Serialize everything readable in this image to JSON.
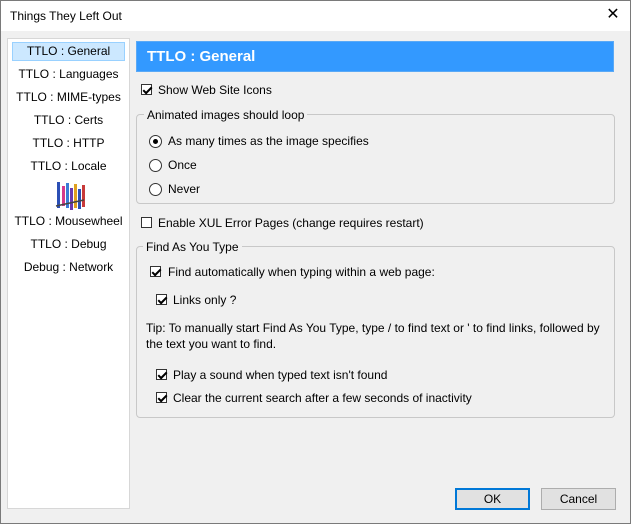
{
  "window": {
    "title": "Things They Left Out"
  },
  "sidebar": {
    "items": [
      {
        "label": "TTLO : General",
        "selected": true
      },
      {
        "label": "TTLO : Languages"
      },
      {
        "label": "TTLO : MIME-types"
      },
      {
        "label": "TTLO : Certs"
      },
      {
        "label": "TTLO : HTTP"
      },
      {
        "label": "TTLO : Locale"
      },
      {
        "label": "TTLO : Mousewheel"
      },
      {
        "label": "TTLO : Debug"
      },
      {
        "label": "Debug : Network"
      }
    ]
  },
  "header": {
    "title": "TTLO : General"
  },
  "general": {
    "show_web_site_icons": {
      "label": "Show Web Site Icons",
      "checked": true
    },
    "animated_group": {
      "legend": "Animated images should loop",
      "options": [
        {
          "label": "As many times as the image specifies",
          "selected": true
        },
        {
          "label": "Once",
          "selected": false
        },
        {
          "label": "Never",
          "selected": false
        }
      ]
    },
    "enable_xul": {
      "label": "Enable XUL Error Pages (change requires restart)",
      "checked": false
    },
    "find_group": {
      "legend": "Find As You Type",
      "find_auto": {
        "label": "Find automatically when typing within a web page:",
        "checked": true
      },
      "links_only": {
        "label": "Links only ?",
        "checked": true
      },
      "tip": "Tip: To manually start Find As You Type, type / to find text or ' to find links, followed by the text you want to find.",
      "play_sound": {
        "label": "Play a sound when typed text isn't found",
        "checked": true
      },
      "clear_search": {
        "label": "Clear the current search after a few seconds of inactivity",
        "checked": true
      }
    }
  },
  "buttons": {
    "ok": "OK",
    "cancel": "Cancel"
  },
  "colors": {
    "header_bg": "#3399ff",
    "selected_bg": "#cce8ff"
  }
}
